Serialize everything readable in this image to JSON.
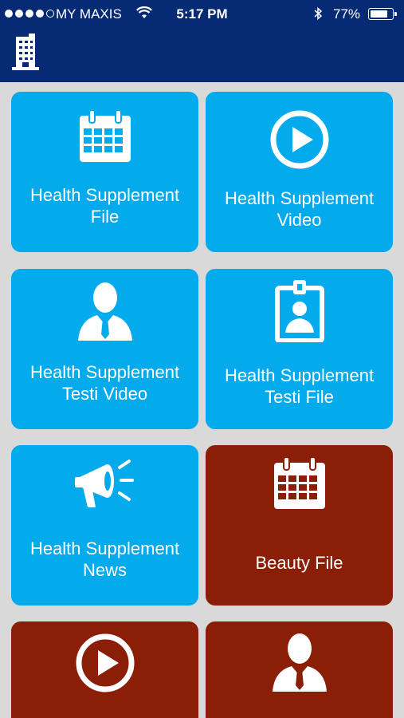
{
  "status_bar": {
    "carrier": "MY MAXIS",
    "time": "5:17 PM",
    "battery_percent": "77%",
    "signal_bars_filled": 4,
    "signal_bars_total": 5
  },
  "header": {
    "logo_icon": "building-icon"
  },
  "colors": {
    "header_bg": "#062a73",
    "tile_blue": "#03aaec",
    "tile_red": "#8b1e06",
    "page_bg": "#d9d9d9"
  },
  "tiles": [
    {
      "line1": "Health Supplement",
      "line2": "File",
      "icon": "calendar-icon",
      "color": "blue"
    },
    {
      "line1": "Health Supplement",
      "line2": "Video",
      "icon": "play-icon",
      "color": "blue"
    },
    {
      "line1": "Health Supplement",
      "line2": "Testi Video",
      "icon": "person-icon",
      "color": "blue"
    },
    {
      "line1": "Health Supplement",
      "line2": "Testi File",
      "icon": "id-badge-icon",
      "color": "blue"
    },
    {
      "line1": "Health Supplement",
      "line2": "News",
      "icon": "megaphone-icon",
      "color": "blue"
    },
    {
      "line1": "Beauty File",
      "line2": "",
      "icon": "calendar-icon",
      "color": "red"
    },
    {
      "line1": "",
      "line2": "",
      "icon": "play-icon",
      "color": "red"
    },
    {
      "line1": "",
      "line2": "",
      "icon": "person-icon",
      "color": "red"
    }
  ]
}
